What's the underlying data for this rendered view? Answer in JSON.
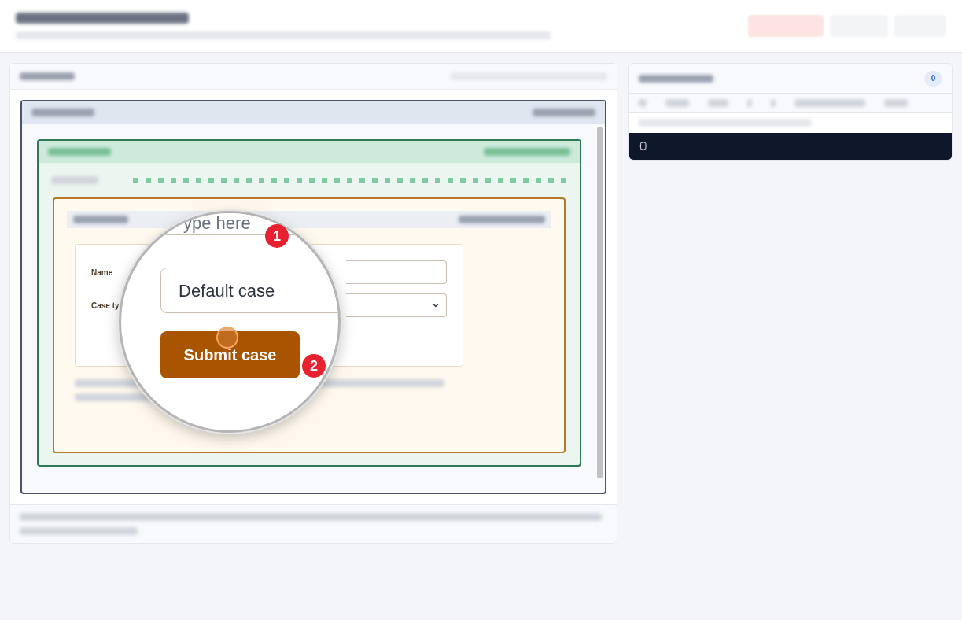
{
  "form": {
    "fields": [
      {
        "label": "Name",
        "kind": "text"
      },
      {
        "label": "Case ty",
        "kind": "select"
      }
    ]
  },
  "magnifier": {
    "placeholder": "ype here",
    "value": "Default case",
    "button": "Submit case",
    "steps": [
      "1",
      "2"
    ]
  },
  "events_panel": {
    "count": "0",
    "code": "{}"
  }
}
